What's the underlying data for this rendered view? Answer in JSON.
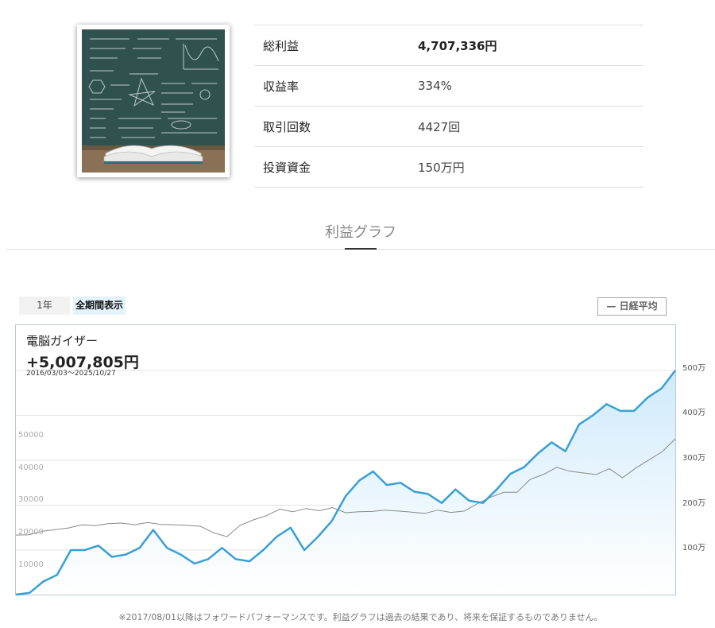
{
  "stats": [
    {
      "label": "総利益",
      "value": "4,707,336円"
    },
    {
      "label": "収益率",
      "value": "334%"
    },
    {
      "label": "取引回数",
      "value": "4427回"
    },
    {
      "label": "投資資金",
      "value": "150万円"
    }
  ],
  "section_title": "利益グラフ",
  "range_tabs": {
    "one_year": "1年",
    "all": "全期間表示"
  },
  "legend_button": "— 日経平均",
  "chart_header": {
    "name": "電脳ガイザー",
    "total": "+5,007,805円",
    "period": "2016/03/03〜2025/10/27"
  },
  "footnote": "※2017/08/01以降はフォワードパフォーマンスです。利益グラフは過去の結果であり、将来を保証するものでありません。",
  "colors": {
    "profit_line": "#3a9fd4",
    "profit_fill": "#cfeafb",
    "nikkei_line": "#888888",
    "frame": "#b7cad6"
  },
  "chart_data": {
    "type": "line",
    "x_range": [
      "2016/03/03",
      "2025/10/27"
    ],
    "left_axis": {
      "ticks": [
        10000,
        20000,
        30000,
        40000,
        50000
      ],
      "labels": [
        "10000",
        "20000",
        "30000",
        "40000",
        "50000"
      ]
    },
    "right_axis": {
      "ticks": [
        1000000,
        2000000,
        3000000,
        4000000,
        5000000
      ],
      "labels": [
        "100万",
        "200万",
        "300万",
        "400万",
        "500万"
      ],
      "ylim": [
        -300000,
        5100000
      ]
    },
    "grid": true,
    "series": [
      {
        "name": "電脳ガイザー",
        "axis": "right",
        "values": [
          -200000,
          50000,
          300000,
          450000,
          1000000,
          1000000,
          1100000,
          850000,
          900000,
          1050000,
          1450000,
          1050000,
          900000,
          700000,
          800000,
          1050000,
          800000,
          750000,
          1000000,
          1300000,
          1500000,
          1000000,
          1300000,
          1650000,
          2200000,
          2550000,
          2750000,
          2450000,
          2500000,
          2300000,
          2250000,
          2050000,
          2350000,
          2100000,
          2050000,
          2350000,
          2700000,
          2850000,
          3150000,
          3400000,
          3200000,
          3800000,
          4000000,
          4250000,
          4100000,
          4100000,
          4400000,
          4600000,
          5000000
        ]
      },
      {
        "name": "日経平均",
        "axis": "left",
        "values": [
          19300,
          19400,
          20500,
          21000,
          21500,
          22500,
          22200,
          22800,
          23000,
          22500,
          23200,
          22600,
          22500,
          22300,
          22000,
          20000,
          18800,
          22300,
          24000,
          25300,
          27300,
          26500,
          27500,
          26800,
          27800,
          26200,
          26500,
          26600,
          27000,
          26700,
          26400,
          26000,
          27000,
          26300,
          26700,
          29000,
          31000,
          32500,
          32500,
          36500,
          38000,
          40200,
          39000,
          38500,
          38000,
          39800,
          37000,
          40000,
          42500,
          45000,
          49000
        ]
      }
    ]
  }
}
